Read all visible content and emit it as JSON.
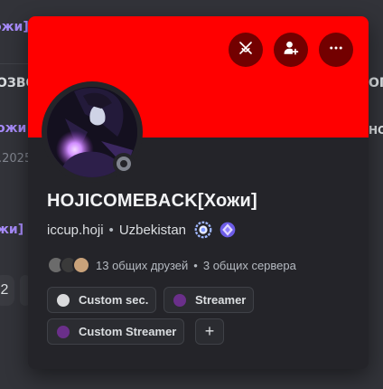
{
  "background": {
    "fragments": [
      "ожи]",
      "ОЗВО",
      "ОГО",
      "ожи",
      "НО",
      ".2025",
      "жи]",
      "2"
    ],
    "accent_purple": "#a78bfa"
  },
  "banner": {
    "color": "#ff0000",
    "buttons": [
      {
        "icon": "swords-icon"
      },
      {
        "icon": "add-friend-icon"
      },
      {
        "icon": "more-icon"
      }
    ]
  },
  "profile": {
    "display_name": "HOJICOMEBACK[Хожи]",
    "username": "iccup.hoji",
    "separator": "•",
    "pronouns_location": "Uzbekistan",
    "status": "offline",
    "badges": [
      "hypesquad-badge",
      "nitro-badge"
    ]
  },
  "mutual": {
    "friends_text": "13 общих друзей",
    "separator": "•",
    "servers_text": "3 общих сервера",
    "avatar_colors": [
      "#6b6b6b",
      "#3a3a3a",
      "#c9a27a"
    ]
  },
  "roles": [
    {
      "label": "Custom sec.",
      "color": "#d9dadc"
    },
    {
      "label": "Streamer",
      "color": "#6a2f8a"
    },
    {
      "label": "Custom Streamer",
      "color": "#6a2f8a"
    }
  ],
  "add_role": "+"
}
